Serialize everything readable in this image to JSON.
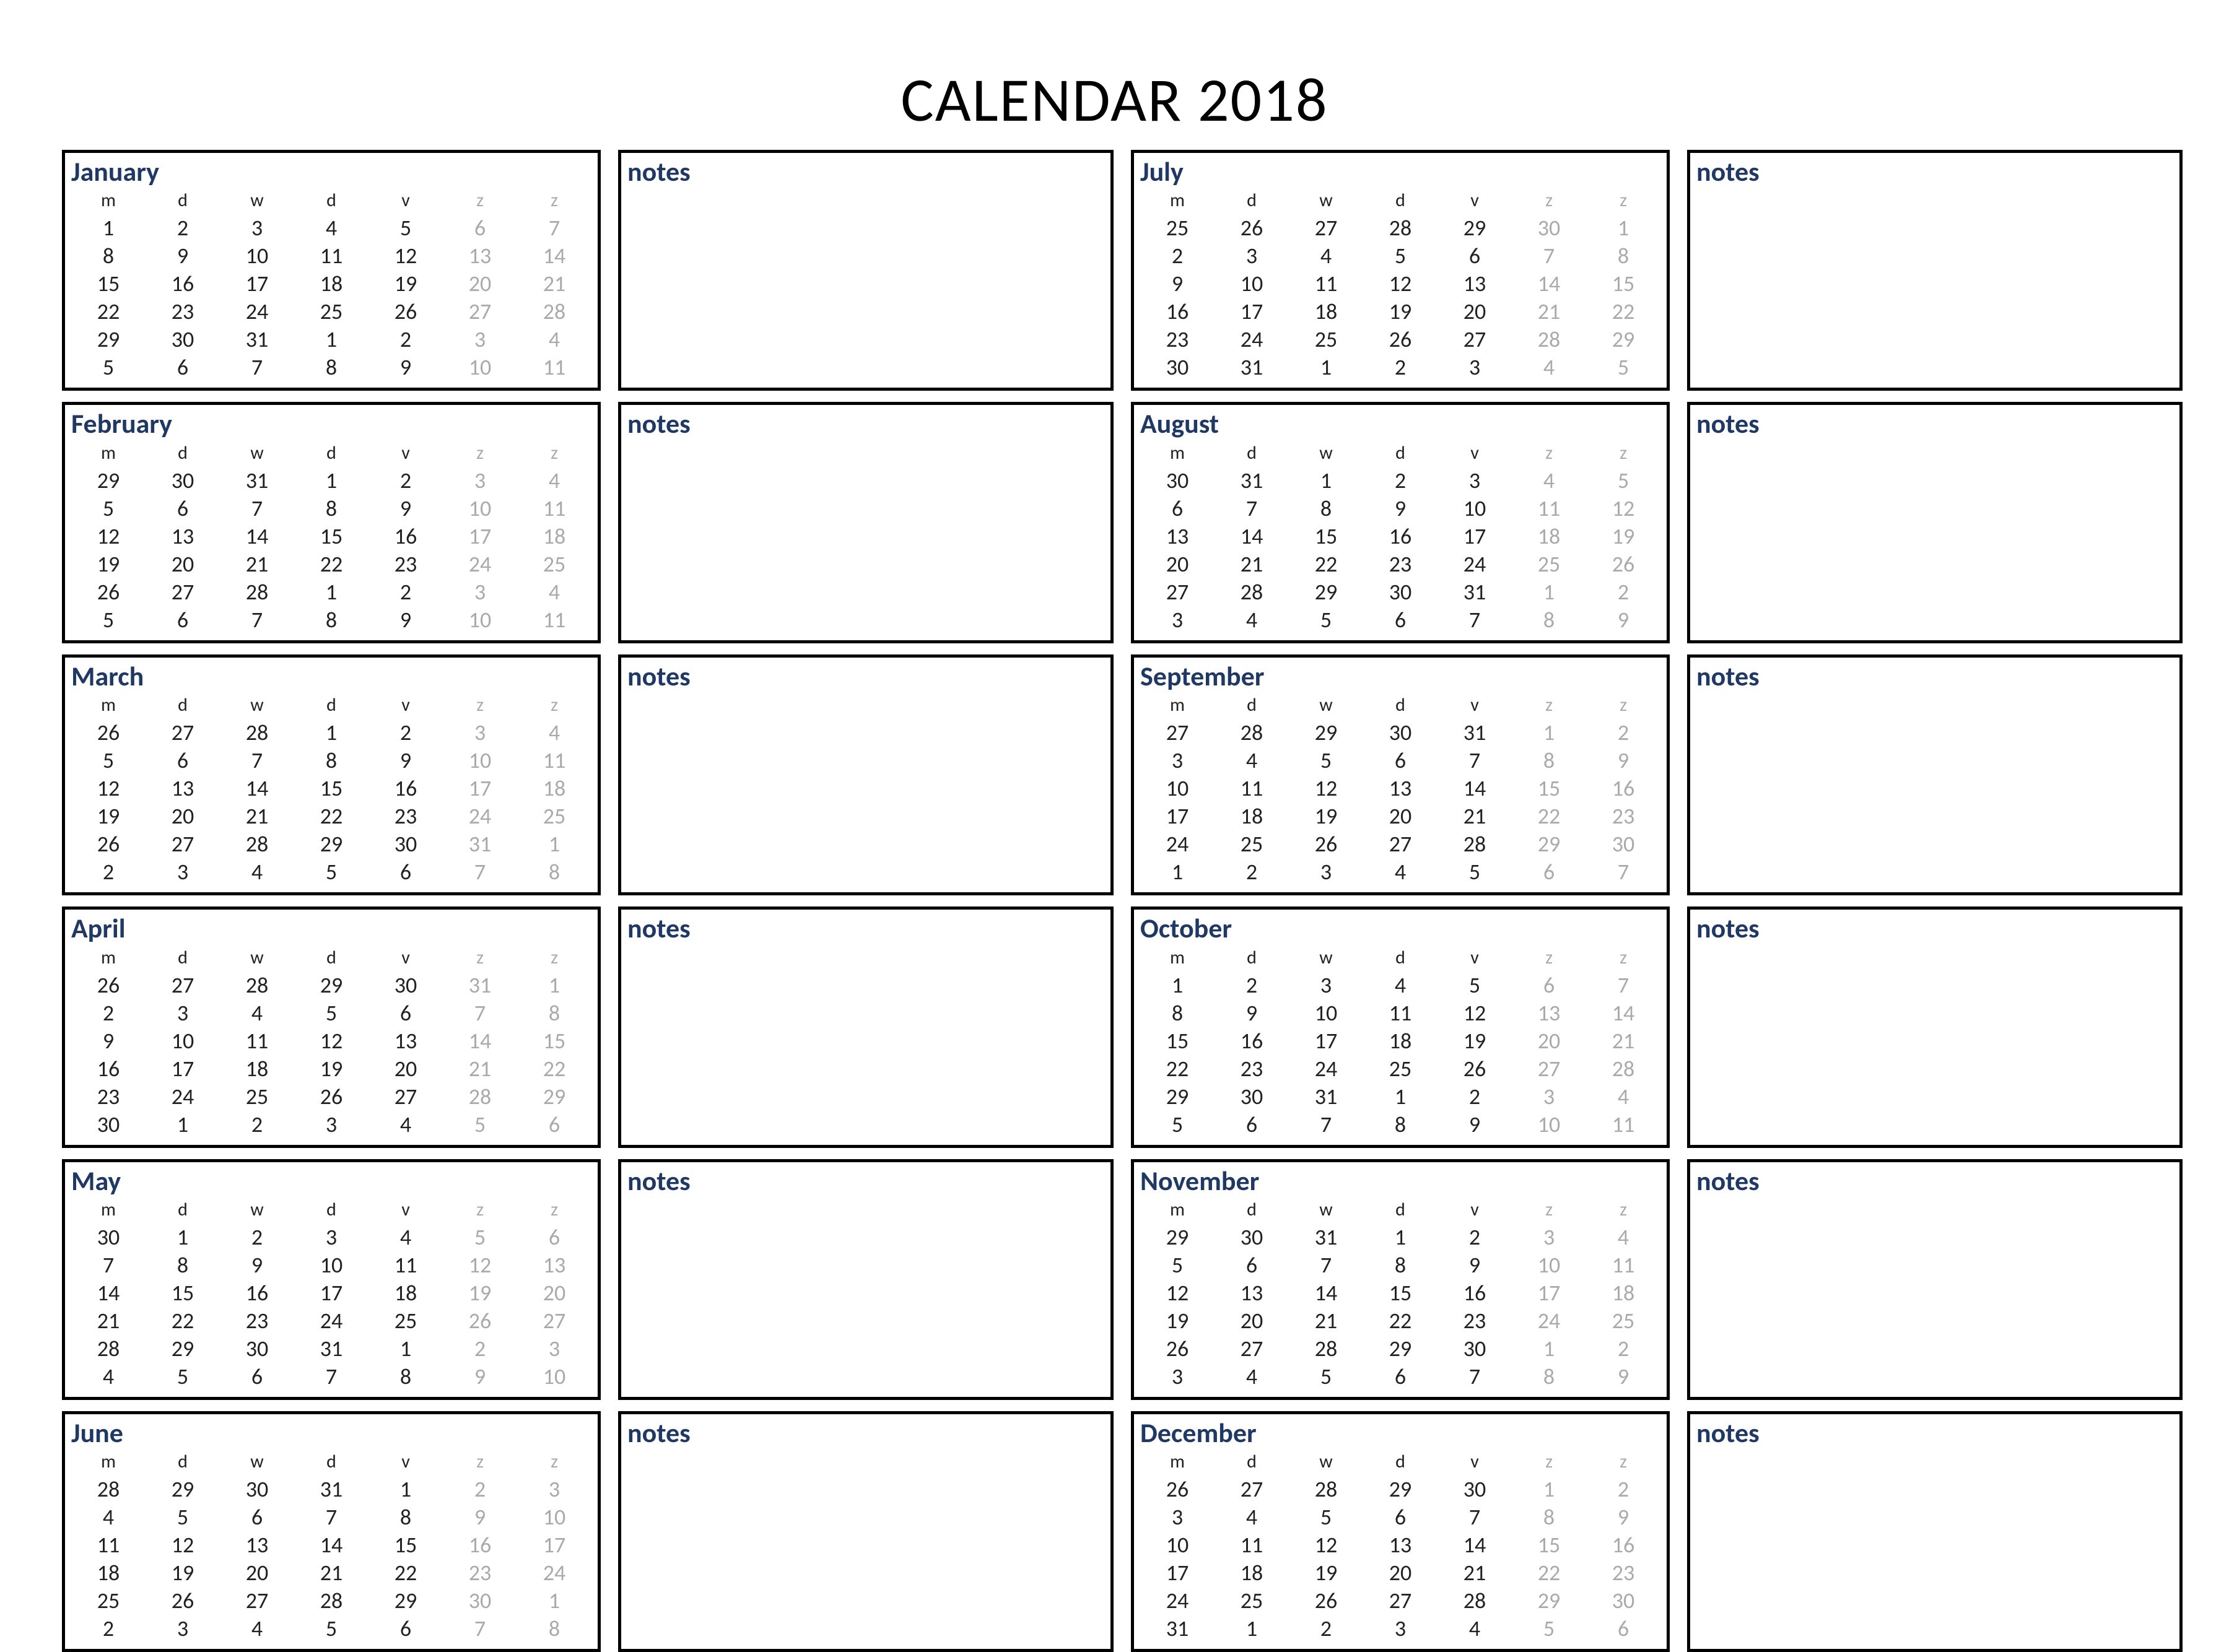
{
  "title": "CALENDAR 2018",
  "notes_label": "notes",
  "day_headers": [
    "m",
    "d",
    "w",
    "d",
    "v",
    "z",
    "z"
  ],
  "months": [
    {
      "name": "January",
      "weeks": [
        [
          1,
          2,
          3,
          4,
          5,
          6,
          7
        ],
        [
          8,
          9,
          10,
          11,
          12,
          13,
          14
        ],
        [
          15,
          16,
          17,
          18,
          19,
          20,
          21
        ],
        [
          22,
          23,
          24,
          25,
          26,
          27,
          28
        ],
        [
          29,
          30,
          31,
          1,
          2,
          3,
          4
        ],
        [
          5,
          6,
          7,
          8,
          9,
          10,
          11
        ]
      ]
    },
    {
      "name": "February",
      "weeks": [
        [
          29,
          30,
          31,
          1,
          2,
          3,
          4
        ],
        [
          5,
          6,
          7,
          8,
          9,
          10,
          11
        ],
        [
          12,
          13,
          14,
          15,
          16,
          17,
          18
        ],
        [
          19,
          20,
          21,
          22,
          23,
          24,
          25
        ],
        [
          26,
          27,
          28,
          1,
          2,
          3,
          4
        ],
        [
          5,
          6,
          7,
          8,
          9,
          10,
          11
        ]
      ]
    },
    {
      "name": "March",
      "weeks": [
        [
          26,
          27,
          28,
          1,
          2,
          3,
          4
        ],
        [
          5,
          6,
          7,
          8,
          9,
          10,
          11
        ],
        [
          12,
          13,
          14,
          15,
          16,
          17,
          18
        ],
        [
          19,
          20,
          21,
          22,
          23,
          24,
          25
        ],
        [
          26,
          27,
          28,
          29,
          30,
          31,
          1
        ],
        [
          2,
          3,
          4,
          5,
          6,
          7,
          8
        ]
      ]
    },
    {
      "name": "April",
      "weeks": [
        [
          26,
          27,
          28,
          29,
          30,
          31,
          1
        ],
        [
          2,
          3,
          4,
          5,
          6,
          7,
          8
        ],
        [
          9,
          10,
          11,
          12,
          13,
          14,
          15
        ],
        [
          16,
          17,
          18,
          19,
          20,
          21,
          22
        ],
        [
          23,
          24,
          25,
          26,
          27,
          28,
          29
        ],
        [
          30,
          1,
          2,
          3,
          4,
          5,
          6
        ]
      ]
    },
    {
      "name": "May",
      "weeks": [
        [
          30,
          1,
          2,
          3,
          4,
          5,
          6
        ],
        [
          7,
          8,
          9,
          10,
          11,
          12,
          13
        ],
        [
          14,
          15,
          16,
          17,
          18,
          19,
          20
        ],
        [
          21,
          22,
          23,
          24,
          25,
          26,
          27
        ],
        [
          28,
          29,
          30,
          31,
          1,
          2,
          3
        ],
        [
          4,
          5,
          6,
          7,
          8,
          9,
          10
        ]
      ]
    },
    {
      "name": "June",
      "weeks": [
        [
          28,
          29,
          30,
          31,
          1,
          2,
          3
        ],
        [
          4,
          5,
          6,
          7,
          8,
          9,
          10
        ],
        [
          11,
          12,
          13,
          14,
          15,
          16,
          17
        ],
        [
          18,
          19,
          20,
          21,
          22,
          23,
          24
        ],
        [
          25,
          26,
          27,
          28,
          29,
          30,
          1
        ],
        [
          2,
          3,
          4,
          5,
          6,
          7,
          8
        ]
      ]
    },
    {
      "name": "July",
      "weeks": [
        [
          25,
          26,
          27,
          28,
          29,
          30,
          1
        ],
        [
          2,
          3,
          4,
          5,
          6,
          7,
          8
        ],
        [
          9,
          10,
          11,
          12,
          13,
          14,
          15
        ],
        [
          16,
          17,
          18,
          19,
          20,
          21,
          22
        ],
        [
          23,
          24,
          25,
          26,
          27,
          28,
          29
        ],
        [
          30,
          31,
          1,
          2,
          3,
          4,
          5
        ]
      ]
    },
    {
      "name": "August",
      "weeks": [
        [
          30,
          31,
          1,
          2,
          3,
          4,
          5
        ],
        [
          6,
          7,
          8,
          9,
          10,
          11,
          12
        ],
        [
          13,
          14,
          15,
          16,
          17,
          18,
          19
        ],
        [
          20,
          21,
          22,
          23,
          24,
          25,
          26
        ],
        [
          27,
          28,
          29,
          30,
          31,
          1,
          2
        ],
        [
          3,
          4,
          5,
          6,
          7,
          8,
          9
        ]
      ]
    },
    {
      "name": "September",
      "weeks": [
        [
          27,
          28,
          29,
          30,
          31,
          1,
          2
        ],
        [
          3,
          4,
          5,
          6,
          7,
          8,
          9
        ],
        [
          10,
          11,
          12,
          13,
          14,
          15,
          16
        ],
        [
          17,
          18,
          19,
          20,
          21,
          22,
          23
        ],
        [
          24,
          25,
          26,
          27,
          28,
          29,
          30
        ],
        [
          1,
          2,
          3,
          4,
          5,
          6,
          7
        ]
      ]
    },
    {
      "name": "October",
      "weeks": [
        [
          1,
          2,
          3,
          4,
          5,
          6,
          7
        ],
        [
          8,
          9,
          10,
          11,
          12,
          13,
          14
        ],
        [
          15,
          16,
          17,
          18,
          19,
          20,
          21
        ],
        [
          22,
          23,
          24,
          25,
          26,
          27,
          28
        ],
        [
          29,
          30,
          31,
          1,
          2,
          3,
          4
        ],
        [
          5,
          6,
          7,
          8,
          9,
          10,
          11
        ]
      ]
    },
    {
      "name": "November",
      "weeks": [
        [
          29,
          30,
          31,
          1,
          2,
          3,
          4
        ],
        [
          5,
          6,
          7,
          8,
          9,
          10,
          11
        ],
        [
          12,
          13,
          14,
          15,
          16,
          17,
          18
        ],
        [
          19,
          20,
          21,
          22,
          23,
          24,
          25
        ],
        [
          26,
          27,
          28,
          29,
          30,
          1,
          2
        ],
        [
          3,
          4,
          5,
          6,
          7,
          8,
          9
        ]
      ]
    },
    {
      "name": "December",
      "weeks": [
        [
          26,
          27,
          28,
          29,
          30,
          1,
          2
        ],
        [
          3,
          4,
          5,
          6,
          7,
          8,
          9
        ],
        [
          10,
          11,
          12,
          13,
          14,
          15,
          16
        ],
        [
          17,
          18,
          19,
          20,
          21,
          22,
          23
        ],
        [
          24,
          25,
          26,
          27,
          28,
          29,
          30
        ],
        [
          31,
          1,
          2,
          3,
          4,
          5,
          6
        ]
      ]
    }
  ]
}
